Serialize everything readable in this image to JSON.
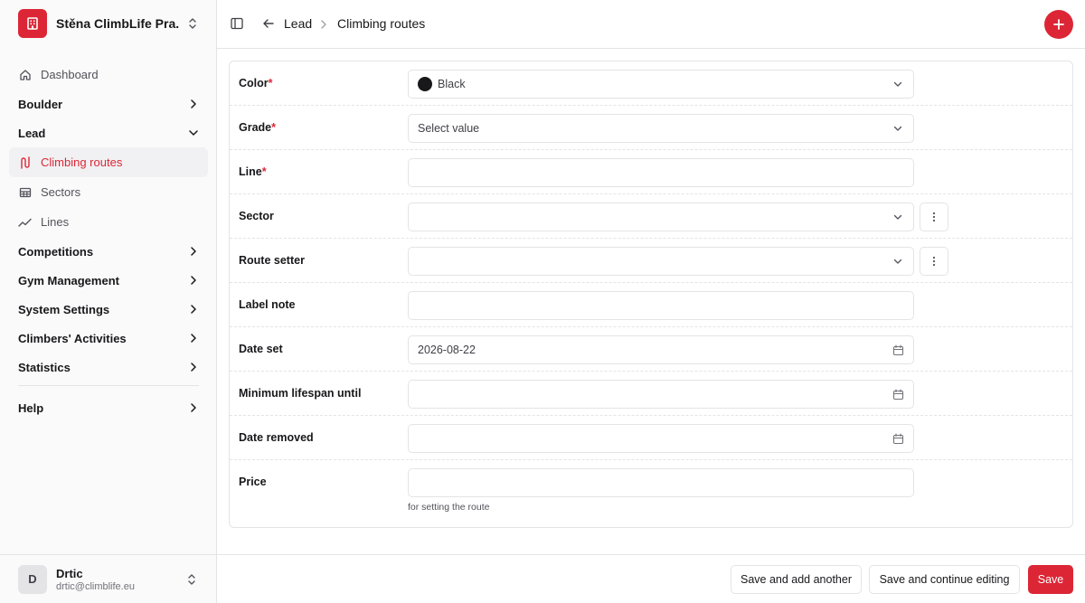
{
  "sidebar": {
    "org_name": "Stěna ClimbLife Pra...",
    "items": {
      "dashboard": "Dashboard",
      "boulder": "Boulder",
      "lead": "Lead",
      "climbing_routes": "Climbing routes",
      "sectors": "Sectors",
      "lines": "Lines",
      "competitions": "Competitions",
      "gym_management": "Gym Management",
      "system_settings": "System Settings",
      "climbers_activities": "Climbers' Activities",
      "statistics": "Statistics",
      "help": "Help"
    },
    "active_item": "Climbing routes",
    "user": {
      "initial": "D",
      "name": "Drtic",
      "email": "drtic@climblife.eu"
    }
  },
  "header": {
    "breadcrumb": [
      "Lead",
      "Climbing routes"
    ]
  },
  "form": {
    "color": {
      "label": "Color",
      "required": true,
      "value": "Black",
      "swatch": "#18181b"
    },
    "grade": {
      "label": "Grade",
      "required": true,
      "value": "Select value"
    },
    "line": {
      "label": "Line",
      "required": true,
      "value": ""
    },
    "sector": {
      "label": "Sector",
      "value": ""
    },
    "route_setter": {
      "label": "Route setter",
      "value": ""
    },
    "label_note": {
      "label": "Label note",
      "value": ""
    },
    "date_set": {
      "label": "Date set",
      "value": "2026-08-22"
    },
    "min_lifespan": {
      "label": "Minimum lifespan until",
      "value": ""
    },
    "date_removed": {
      "label": "Date removed",
      "value": ""
    },
    "price": {
      "label": "Price",
      "value": "",
      "help": "for setting the route"
    }
  },
  "footer": {
    "save_add_another": "Save and add another",
    "save_continue": "Save and continue editing",
    "save": "Save"
  },
  "colors": {
    "accent": "#dc2636",
    "border": "#e4e4e7",
    "sidebar_bg": "#fafafa"
  },
  "icons": {
    "org_logo": "building-icon",
    "sidebar_toggle": "sidebar-toggle-icon",
    "back": "arrow-left-icon",
    "add": "plus-icon",
    "calendar": "calendar-icon",
    "more": "more-vertical-icon"
  }
}
